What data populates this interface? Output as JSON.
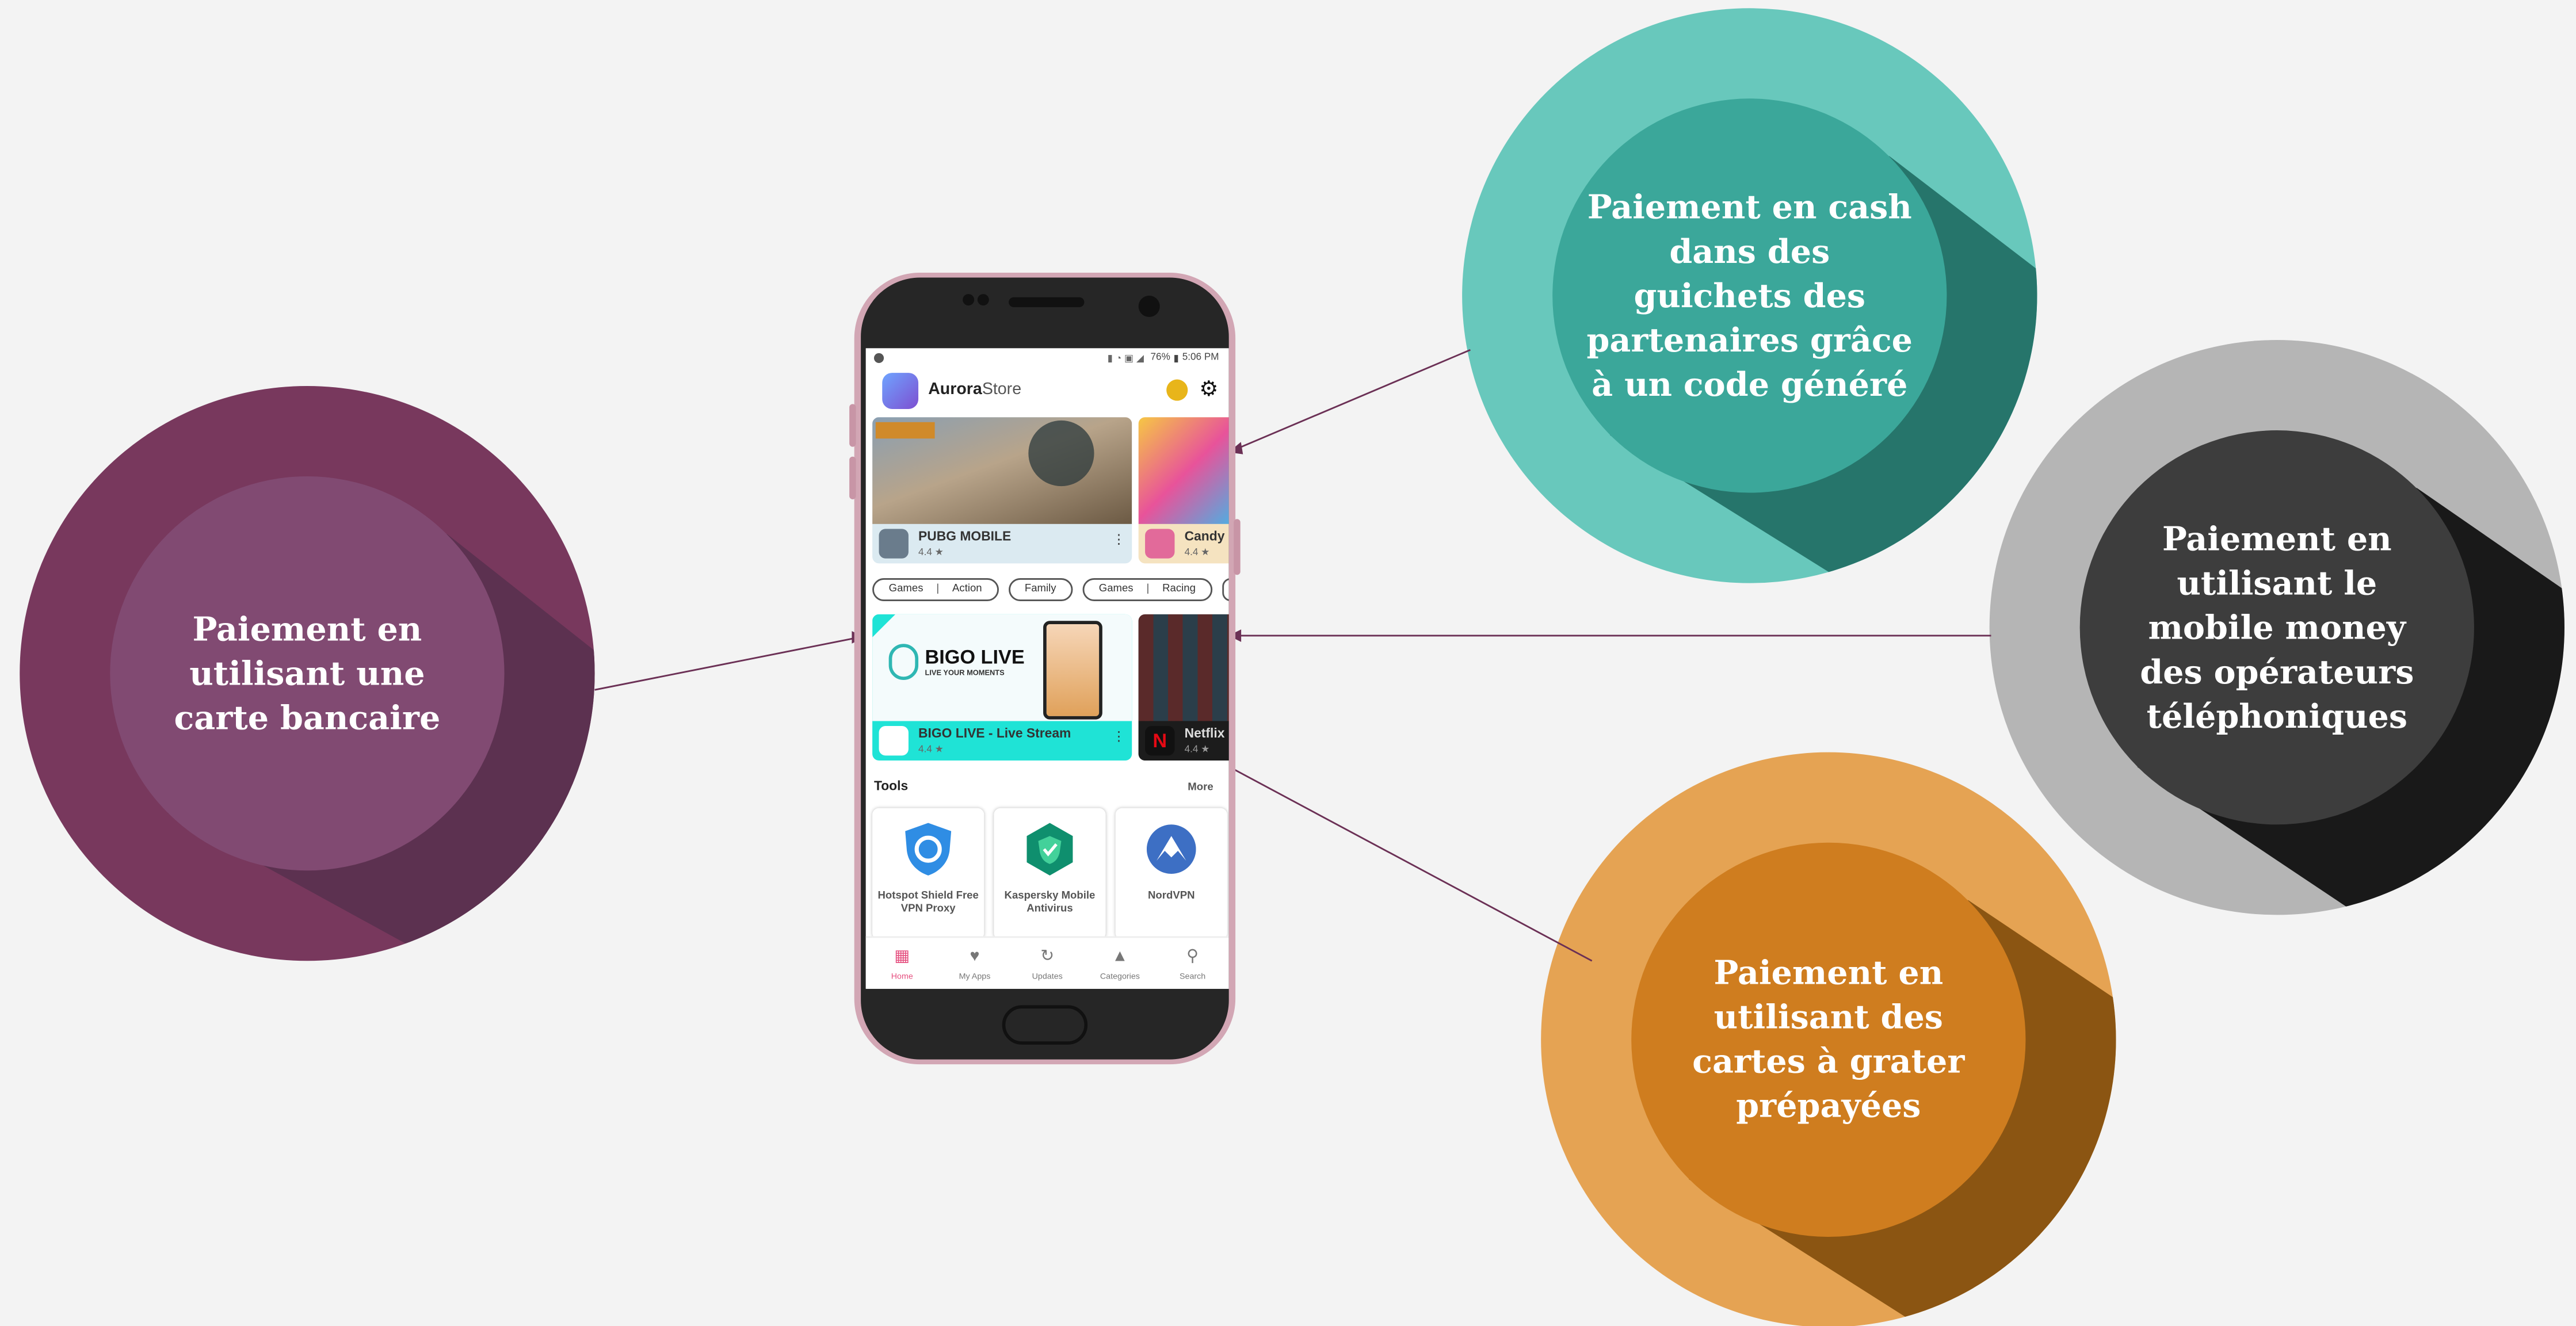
{
  "diagram": {
    "nodes": [
      {
        "id": "card",
        "text": "Paiement en utilisant une carte bancaire",
        "colors": {
          "outer": "#78385d",
          "inner": "#814a72",
          "shadow": "#5c3150"
        }
      },
      {
        "id": "cash",
        "text": "Paiement en cash dans des guichets des partenaires grâce à un code généré",
        "colors": {
          "outer": "#68c8bc",
          "inner": "#3ba79a",
          "shadow": "#26756b"
        }
      },
      {
        "id": "mobile",
        "text": "Paiement en utilisant le mobile money des opérateurs téléphoniques",
        "colors": {
          "outer": "#b5b5b5",
          "inner": "#3d3d3d",
          "shadow": "#191919"
        }
      },
      {
        "id": "prepaid",
        "text": "Paiement en utilisant des cartes à grater prépayées",
        "colors": {
          "outer": "#e5a353",
          "inner": "#cf7d1f",
          "shadow": "#8b5512"
        }
      }
    ],
    "connector_color": "#6b3055"
  },
  "phone": {
    "status": {
      "battery": "76%",
      "time": "5:06 PM"
    },
    "app": {
      "name_bold": "Aurora",
      "name_rest": "Store"
    },
    "featured": [
      {
        "title": "PUBG MOBILE",
        "rating": "4.4 ★"
      },
      {
        "title": "Candy C",
        "rating": "4.4 ★"
      }
    ],
    "chips": [
      {
        "parts": [
          "Games",
          "Action"
        ]
      },
      {
        "parts": [
          "Family"
        ]
      },
      {
        "parts": [
          "Games",
          "Racing"
        ]
      }
    ],
    "featured2": [
      {
        "title": "BIGO LIVE - Live Stream",
        "rating": "4.4 ★",
        "banner_title": "BIGO LIVE",
        "banner_sub": "LIVE YOUR MOMENTS"
      },
      {
        "title": "Netflix",
        "rating": "4.4 ★"
      }
    ],
    "tools": {
      "heading": "Tools",
      "more": "More",
      "items": [
        {
          "name": "Hotspot Shield Free VPN Proxy",
          "icon": "shield-icon"
        },
        {
          "name": "Kaspersky Mobile Antivirus",
          "icon": "hexagon-shield-icon"
        },
        {
          "name": "NordVPN",
          "icon": "mountain-icon"
        }
      ]
    },
    "nav": [
      {
        "label": "Home",
        "icon": "home-icon",
        "active": true
      },
      {
        "label": "My Apps",
        "icon": "heart-icon",
        "active": false
      },
      {
        "label": "Updates",
        "icon": "updates-icon",
        "active": false
      },
      {
        "label": "Categories",
        "icon": "categories-icon",
        "active": false
      },
      {
        "label": "Search",
        "icon": "search-icon",
        "active": false
      }
    ]
  }
}
